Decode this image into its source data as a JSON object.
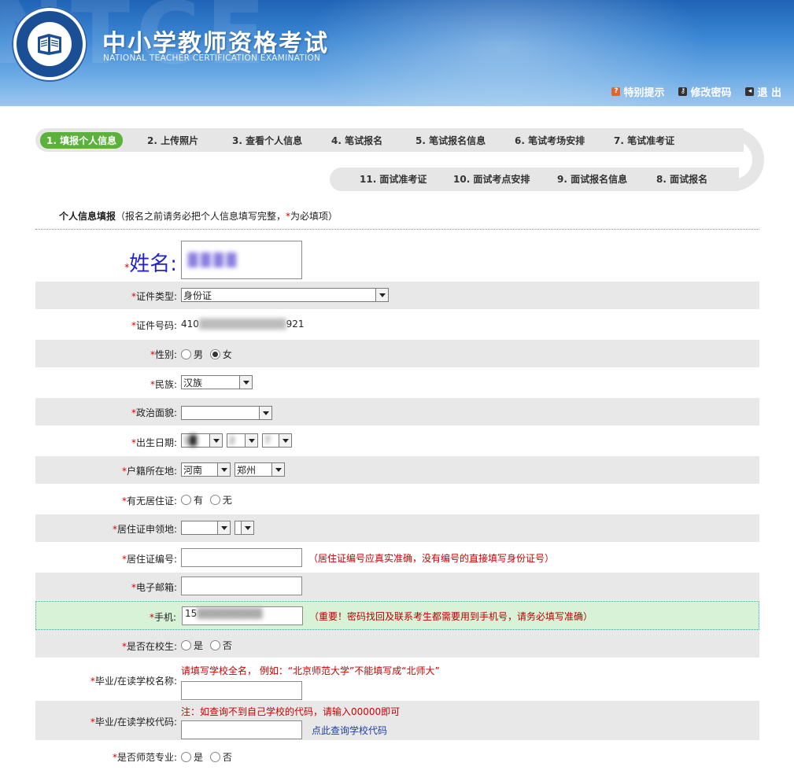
{
  "header": {
    "title": "中小学教师资格考试",
    "subtitle": "NATIONAL TEACHER CERTIFICATION EXAMINATION",
    "watermark": "NTCE",
    "links": [
      {
        "label": "特别提示",
        "icon": "help-icon",
        "color": "#e2662a"
      },
      {
        "label": "修改密码",
        "icon": "key-icon",
        "color": "#333333"
      },
      {
        "label": "退 出",
        "icon": "exit-icon",
        "color": "#333333"
      }
    ]
  },
  "steps": {
    "row1": [
      "1. 填报个人信息",
      "2. 上传照片",
      "3. 查看个人信息",
      "4. 笔试报名",
      "5. 笔试报名信息",
      "6. 笔试考场安排",
      "7. 笔试准考证"
    ],
    "row2": [
      "11. 面试准考证",
      "10. 面试考点安排",
      "9. 面试报名信息",
      "8. 面试报名"
    ],
    "active_index": 0,
    "active_color": "#5cb03c"
  },
  "section": {
    "title": "个人信息填报",
    "note_prefix": "（报名之前请务必把个人信息填写完整，",
    "required_mark": "*",
    "note_suffix": "为必填项）"
  },
  "form": {
    "name": {
      "label": "姓名:",
      "value": "████"
    },
    "id_type": {
      "label": "证件类型:",
      "value": "身份证"
    },
    "id_number": {
      "label": "证件号码:",
      "value_start": "410",
      "value_hidden": "████████████",
      "value_end": "921"
    },
    "gender": {
      "label": "性别:",
      "options": [
        "男",
        "女"
      ],
      "selected": "女"
    },
    "ethnicity": {
      "label": "民族:",
      "value": "汉族"
    },
    "political": {
      "label": "政治面貌:",
      "value": ""
    },
    "birth": {
      "label": "出生日期:",
      "year": "1█",
      "month": "2",
      "day": "7"
    },
    "hukou": {
      "label": "户籍所在地:",
      "province": "河南",
      "city": "郑州"
    },
    "residence_permit": {
      "label": "有无居住证:",
      "options": [
        "有",
        "无"
      ],
      "selected": ""
    },
    "permit_place": {
      "label": "居住证申领地:"
    },
    "permit_number": {
      "label": "居住证编号:",
      "hint": "（居住证编号应真实准确，没有编号的直接填写身份证号）"
    },
    "email": {
      "label": "电子邮箱:",
      "value": ""
    },
    "phone": {
      "label": "手机:",
      "value_start": "15",
      "value_hidden": "█████████",
      "hint": "（重要！密码找回及联系考生都需要用到手机号，请务必填写准确）"
    },
    "in_school": {
      "label": "是否在校生:",
      "options": [
        "是",
        "否"
      ],
      "selected": ""
    },
    "school_name": {
      "label": "毕业/在读学校名称:",
      "hint": "请填写学校全名， 例如：“北京师范大学”不能填写成“北师大”"
    },
    "school_code": {
      "label": "毕业/在读学校代码:",
      "hint": "注：如查询不到自己学校的代码，请输入00000即可",
      "link": "点此查询学校代码"
    },
    "normal_major": {
      "label": "是否师范专业:",
      "options": [
        "是",
        "否"
      ],
      "selected": ""
    }
  }
}
